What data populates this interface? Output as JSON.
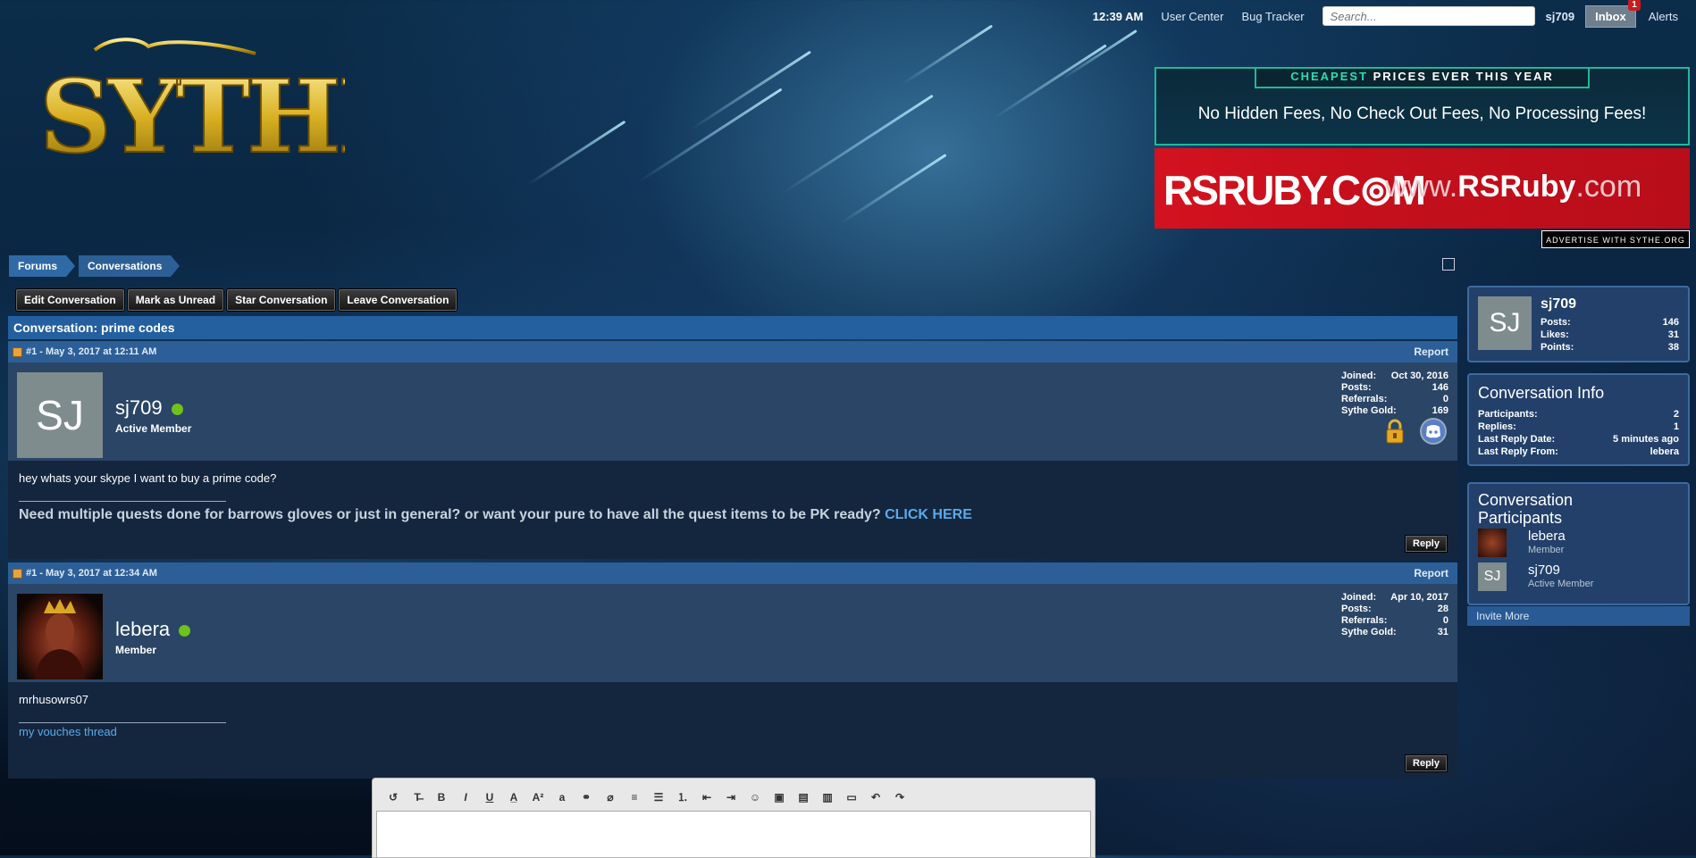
{
  "topbar": {
    "time": "12:39 AM",
    "user_center": "User Center",
    "bug_tracker": "Bug Tracker",
    "search_placeholder": "Search...",
    "username": "sj709",
    "inbox": "Inbox",
    "inbox_count": "1",
    "alerts": "Alerts"
  },
  "logo_text": "SYTHE",
  "ads": {
    "ad1_head_accent": "CHEAPEST",
    "ad1_head_rest": " PRICES EVER THIS YEAR",
    "ad1_sub": "No Hidden Fees, No Check Out Fees, No Processing Fees!",
    "ad2_left": "RSRUBY.C⊚M",
    "ad2_right_pre": "www.",
    "ad2_right_bold": "RSRuby",
    "ad2_right_post": ".com",
    "advertise": "ADVERTISE WITH SYTHE.ORG"
  },
  "breadcrumb": {
    "forums": "Forums",
    "conversations": "Conversations"
  },
  "actions": {
    "edit": "Edit Conversation",
    "unread": "Mark as Unread",
    "star": "Star Conversation",
    "leave": "Leave Conversation"
  },
  "conversation_title": "Conversation: prime codes",
  "posts": [
    {
      "header": "#1 - May 3, 2017 at 12:11 AM",
      "report": "Report",
      "avatar_initials": "SJ",
      "username": "sj709",
      "role": "Active Member",
      "stats": [
        {
          "label": "Joined:",
          "value": "Oct 30, 2016"
        },
        {
          "label": "Posts:",
          "value": "146"
        },
        {
          "label": "Referrals:",
          "value": "0"
        },
        {
          "label": "Sythe Gold:",
          "value": "169"
        }
      ],
      "message": "hey whats your skype I want to buy a prime code?",
      "signature": "Need multiple quests done for barrows gloves or just in general? or want your pure to have all the quest items to be PK ready?",
      "signature_link": "CLICK HERE",
      "reply": "Reply"
    },
    {
      "header": "#1 - May 3, 2017 at 12:34 AM",
      "report": "Report",
      "username": "lebera",
      "role": "Member",
      "stats": [
        {
          "label": "Joined:",
          "value": "Apr 10, 2017"
        },
        {
          "label": "Posts:",
          "value": "28"
        },
        {
          "label": "Referrals:",
          "value": "0"
        },
        {
          "label": "Sythe Gold:",
          "value": "31"
        }
      ],
      "message": "mrhusowrs07",
      "signature_link": "my vouches thread",
      "reply": "Reply"
    }
  ],
  "sidebar": {
    "profile": {
      "initials": "SJ",
      "username": "sj709",
      "stats": [
        {
          "label": "Posts:",
          "value": "146"
        },
        {
          "label": "Likes:",
          "value": "31"
        },
        {
          "label": "Points:",
          "value": "38"
        }
      ]
    },
    "info": {
      "title": "Conversation Info",
      "rows": [
        {
          "label": "Participants:",
          "value": "2"
        },
        {
          "label": "Replies:",
          "value": "1"
        },
        {
          "label": "Last Reply Date:",
          "value": "5 minutes ago"
        },
        {
          "label": "Last Reply From:",
          "value": "lebera"
        }
      ]
    },
    "participants": {
      "title": "Conversation Participants",
      "list": [
        {
          "name": "lebera",
          "role": "Member"
        },
        {
          "name": "sj709",
          "role": "Active Member",
          "initials": "SJ"
        }
      ],
      "invite": "Invite More"
    }
  }
}
